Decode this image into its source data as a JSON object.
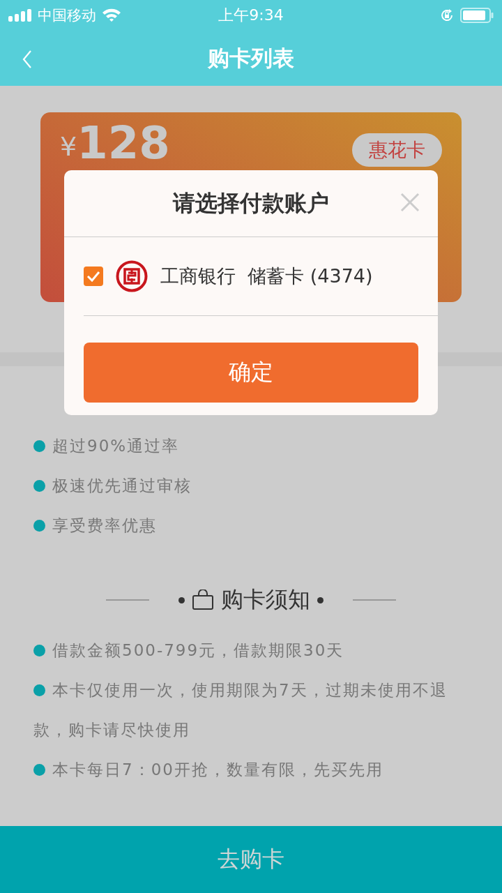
{
  "status_bar": {
    "carrier": "中国移动",
    "time": "上午9:34"
  },
  "nav": {
    "title": "购卡列表"
  },
  "card": {
    "currency": "¥",
    "price": "128",
    "tag": "惠花卡"
  },
  "dialog": {
    "title": "请选择付款账户",
    "accounts": [
      {
        "bank": "工商银行",
        "card": "储蓄卡 (4374)",
        "checked": true
      }
    ],
    "confirm": "确定"
  },
  "benefits": [
    "超过90%通过率",
    "极速优先通过审核",
    "享受费率优惠"
  ],
  "notice": {
    "title": "购卡须知",
    "items": [
      "借款金额500-799元，借款期限30天",
      "本卡仅使用一次，使用期限为7天，过期未使用不退款，购卡请尽快使用",
      "本卡每日7：00开抢，数量有限，先买先用"
    ]
  },
  "bottom_button": "去购卡"
}
